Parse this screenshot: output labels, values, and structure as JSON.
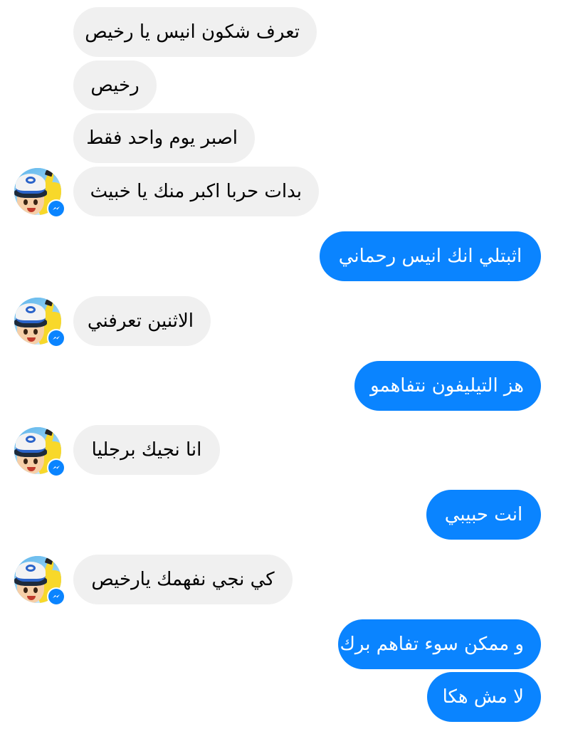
{
  "conversation": {
    "messages": [
      {
        "sender": "contact",
        "text": "تعرف شكون انيس يا رخيص"
      },
      {
        "sender": "contact",
        "text": "رخيص"
      },
      {
        "sender": "contact",
        "text": "اصبر يوم واحد فقط"
      },
      {
        "sender": "contact",
        "text": "بدات حربا اكبر منك يا خبيث"
      },
      {
        "sender": "me",
        "text": "اثبتلي انك انيس رحماني"
      },
      {
        "sender": "contact",
        "text": "الاثنين تعرفني"
      },
      {
        "sender": "me",
        "text": "هز التيليفون نتفاهمو"
      },
      {
        "sender": "contact",
        "text": "انا نجيك برجليا"
      },
      {
        "sender": "me",
        "text": "انت حبيبي"
      },
      {
        "sender": "contact",
        "text": "كي نجي نفهمك يارخيص"
      },
      {
        "sender": "me",
        "text": "و ممكن سوء تفاهم برك"
      },
      {
        "sender": "me",
        "text": "لا مش هكا"
      }
    ]
  },
  "avatar": {
    "icon": "contact-avatar-ash-pikachu",
    "badge_icon": "messenger-icon"
  },
  "colors": {
    "incoming_bubble": "#f0f0f0",
    "outgoing_bubble": "#0a84ff",
    "incoming_text": "#000000",
    "outgoing_text": "#ffffff",
    "background": "#ffffff"
  }
}
